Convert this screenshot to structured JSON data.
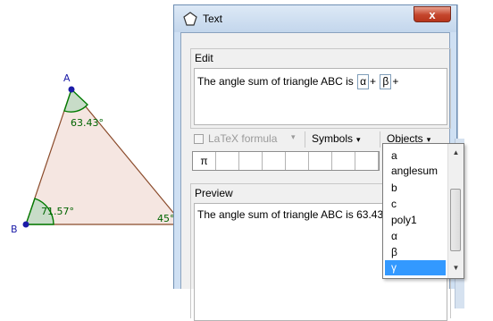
{
  "geometry": {
    "points": [
      "A",
      "B"
    ],
    "angles": [
      "63.43°",
      "71.57°",
      "45°"
    ],
    "colors": {
      "fill": "#f5e6e1",
      "edge": "#8b4b2b",
      "point": "#1c1ca8",
      "angle_arc": "#007a00",
      "angle_text": "#006400"
    }
  },
  "dialog": {
    "title": "Text",
    "close_label": "x",
    "edit_legend": "Edit",
    "edit_text_before": "The angle sum of triangle ABC is",
    "edit_box_1": "α",
    "edit_plus_1": "+",
    "edit_box_2": "β",
    "edit_plus_2": "+",
    "latex_label": "LaTeX formula",
    "latex_arrow": "▾",
    "symbols_label": "Symbols",
    "objects_label": "Objects",
    "dropdown_arrow": "▾",
    "symbol_row": [
      "π",
      "",
      "",
      "",
      "",
      "",
      "",
      ""
    ],
    "preview_legend": "Preview",
    "preview_text": "The angle sum of triangle ABC is 63.43"
  },
  "objects_list": {
    "items": [
      "a",
      "anglesum",
      "b",
      "c",
      "poly1",
      "α",
      "β",
      "γ"
    ],
    "selected": "γ",
    "scroll_up": "▲",
    "scroll_down": "▼"
  }
}
